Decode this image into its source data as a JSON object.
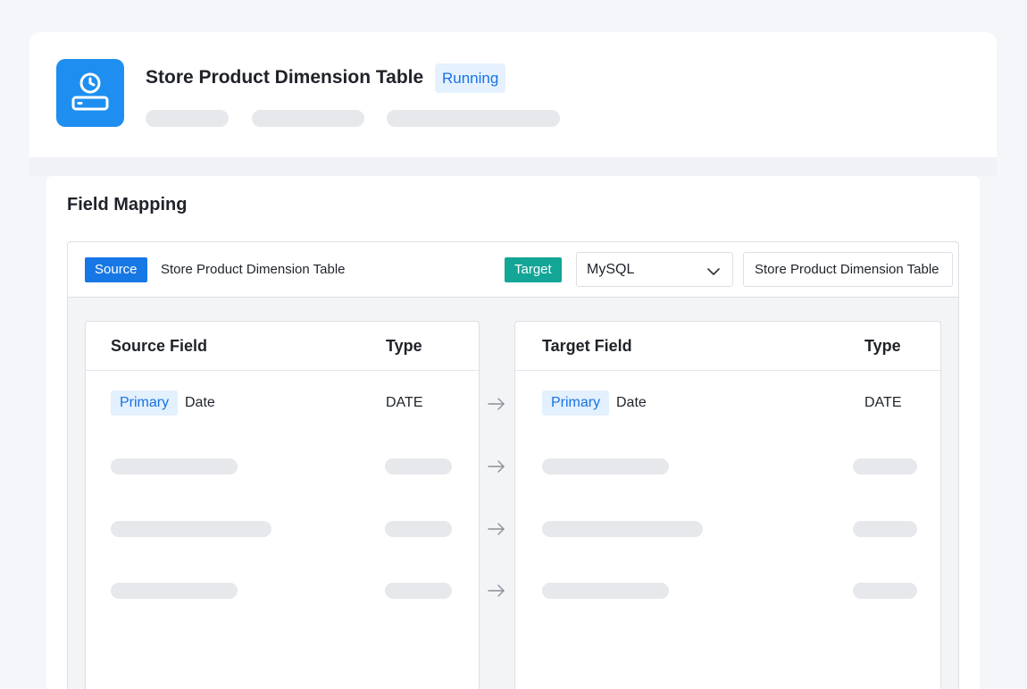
{
  "header": {
    "title": "Store Product Dimension Table",
    "status": "Running",
    "icon": "clock-server-icon"
  },
  "field_mapping": {
    "title": "Field Mapping",
    "toolbar": {
      "source_tag": "Source",
      "source_table": "Store Product Dimension Table",
      "target_tag": "Target",
      "db_type": "MySQL",
      "target_table": "Store Product Dimension Table"
    },
    "source_panel": {
      "field_header": "Source Field",
      "type_header": "Type",
      "rows": [
        {
          "tag": "Primary",
          "name": "Date",
          "type": "DATE"
        }
      ]
    },
    "target_panel": {
      "field_header": "Target Field",
      "type_header": "Type",
      "rows": [
        {
          "tag": "Primary",
          "name": "Date",
          "type": "DATE"
        }
      ]
    }
  },
  "colors": {
    "accent_blue": "#1e8ff0",
    "source_tag": "#1677e5",
    "target_tag": "#13a596",
    "status_bg": "#e6f1ff",
    "status_text": "#1673e6"
  }
}
